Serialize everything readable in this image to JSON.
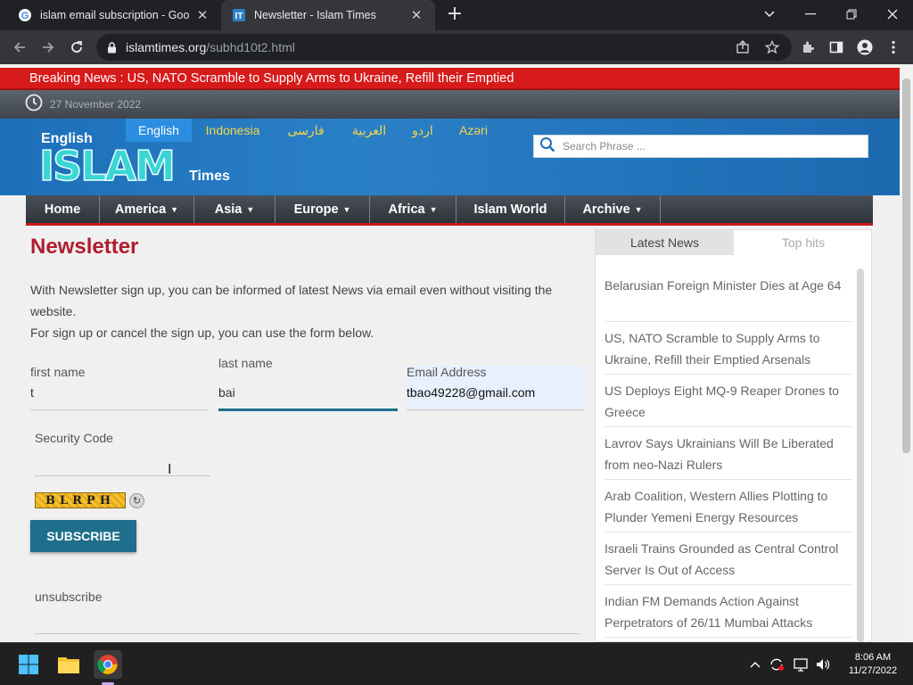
{
  "browser": {
    "tabs": [
      {
        "title": "islam email subscription - Google",
        "icon": "google-icon"
      },
      {
        "title": "Newsletter - Islam Times",
        "icon": "islam-times-icon"
      }
    ],
    "url_host": "islamtimes.org",
    "url_path": "/subhd10t2.html"
  },
  "site": {
    "breaking": "Breaking News : US, NATO Scramble to Supply Arms to Ukraine, Refill their Emptied",
    "date": "27 November 2022",
    "logo": {
      "top": "English",
      "main": "ISLAM",
      "bottom": "Times"
    },
    "languages": [
      "English",
      "Indonesia",
      "فارسی",
      "العربية",
      "اردو",
      "Azəri"
    ],
    "search_placeholder": "Search Phrase ...",
    "menu": [
      {
        "label": "Home",
        "caret": ""
      },
      {
        "label": "America",
        "caret": "▼"
      },
      {
        "label": "Asia",
        "caret": "▼"
      },
      {
        "label": "Europe",
        "caret": "▼"
      },
      {
        "label": "Africa",
        "caret": "▼"
      },
      {
        "label": "Islam World",
        "caret": ""
      },
      {
        "label": "Archive",
        "caret": "▼"
      }
    ]
  },
  "newsletter": {
    "title": "Newsletter",
    "intro1": "With Newsletter sign up, you can be informed of latest News via email even without visiting the website.",
    "intro2": "For sign up or cancel the sign up, you can use the form below.",
    "first_name_label": "first name",
    "first_name_value": "t",
    "last_name_label": "last name",
    "last_name_value": "bai",
    "email_label": "Email Address",
    "email_value": "tbao49228@gmail.com",
    "security_label": "Security Code",
    "captcha_text": "BLRPH",
    "subscribe_label": "SUBSCRIBE",
    "unsubscribe_label": "unsubscribe"
  },
  "sidebar": {
    "tabs": [
      "Latest News",
      "Top hits"
    ],
    "news": [
      "Belarusian Foreign Minister Dies at Age 64",
      "US, NATO Scramble to Supply Arms to Ukraine, Refill their Emptied Arsenals",
      "US Deploys Eight MQ-9 Reaper Drones to Greece",
      "Lavrov Says Ukrainians Will Be Liberated from neo-Nazi Rulers",
      "Arab Coalition, Western Allies Plotting to Plunder Yemeni Energy Resources",
      "Israeli Trains Grounded as Central Control Server Is Out of Access",
      "Indian FM Demands Action Against Perpetrators of 26/11 Mumbai Attacks"
    ]
  },
  "taskbar": {
    "time": "8:06 AM",
    "date": "11/27/2022"
  }
}
